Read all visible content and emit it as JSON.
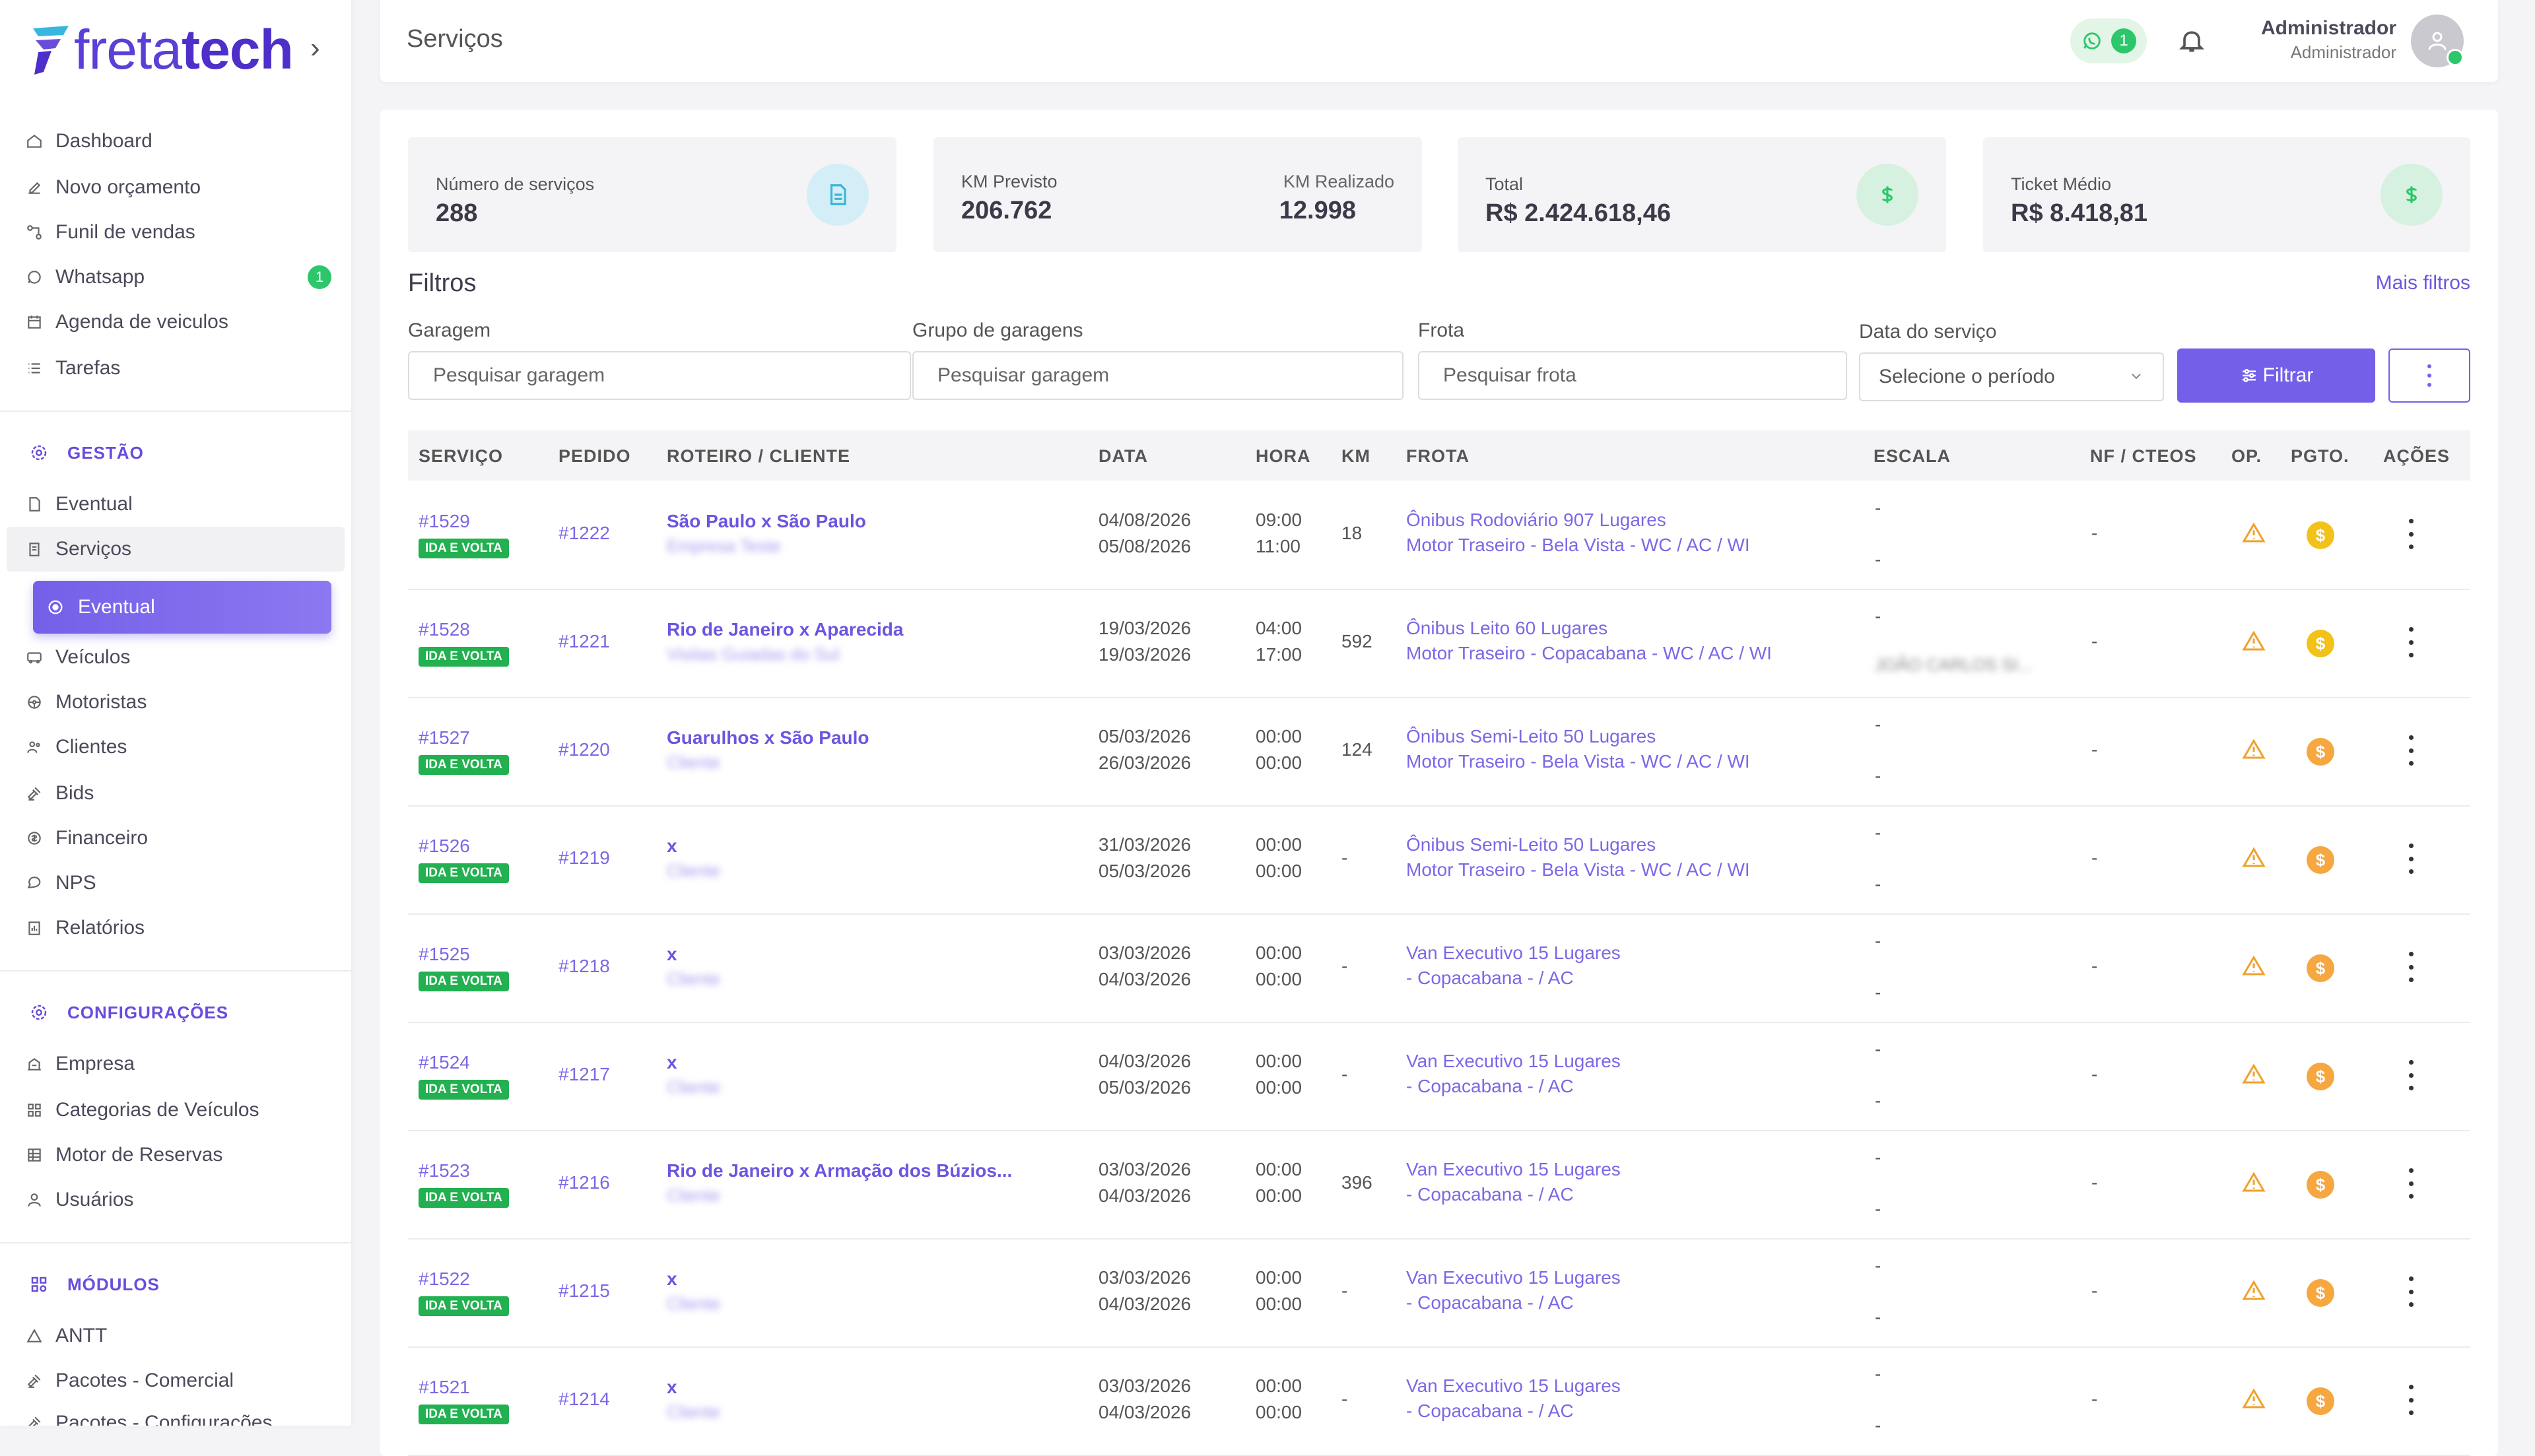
{
  "brand": {
    "name_light": "freta",
    "name_bold": "tech",
    "accent": "#6a4cdc"
  },
  "sidebar": {
    "top_items": [
      {
        "label": "Dashboard",
        "icon": "home-icon"
      },
      {
        "label": "Novo orçamento",
        "icon": "edit-icon"
      },
      {
        "label": "Funil de vendas",
        "icon": "funnel-icon"
      },
      {
        "label": "Whatsapp",
        "icon": "whatsapp-icon",
        "badge": "1"
      },
      {
        "label": "Agenda de veiculos",
        "icon": "calendar-icon"
      },
      {
        "label": "Tarefas",
        "icon": "list-icon"
      }
    ],
    "gestao": {
      "title": "GESTÃO",
      "items": [
        {
          "label": "Eventual",
          "icon": "document-icon"
        },
        {
          "label": "Serviços",
          "icon": "clipboard-icon"
        },
        {
          "label": "Veículos",
          "icon": "bus-icon"
        },
        {
          "label": "Motoristas",
          "icon": "steering-wheel-icon"
        },
        {
          "label": "Clientes",
          "icon": "users-icon"
        },
        {
          "label": "Bids",
          "icon": "gavel-icon"
        },
        {
          "label": "Financeiro",
          "icon": "money-icon"
        },
        {
          "label": "NPS",
          "icon": "chat-icon"
        },
        {
          "label": "Relatórios",
          "icon": "report-icon"
        }
      ],
      "active_sub": "Eventual"
    },
    "configuracoes": {
      "title": "CONFIGURAÇÕES",
      "items": [
        {
          "label": "Empresa",
          "icon": "building-icon"
        },
        {
          "label": "Categorias de Veículos",
          "icon": "grid-icon"
        },
        {
          "label": "Motor de Reservas",
          "icon": "table-icon"
        },
        {
          "label": "Usuários",
          "icon": "user-icon"
        }
      ]
    },
    "modulos": {
      "title": "MÓDULOS",
      "items": [
        {
          "label": "ANTT",
          "icon": "triangle-icon"
        },
        {
          "label": "Pacotes - Comercial",
          "icon": "gavel-icon"
        },
        {
          "label": "Pacotes - Configurações",
          "icon": "gavel-icon"
        }
      ]
    }
  },
  "header": {
    "title": "Serviços",
    "whatsapp_count": "1",
    "user_name": "Administrador",
    "user_role": "Administrador"
  },
  "stats": {
    "servicos": {
      "label": "Número de serviços",
      "value": "288"
    },
    "km_previsto": {
      "label": "KM Previsto",
      "value": "206.762"
    },
    "km_realizado": {
      "label": "KM Realizado",
      "value": "12.998"
    },
    "total": {
      "label": "Total",
      "value": "R$ 2.424.618,46"
    },
    "ticket": {
      "label": "Ticket Médio",
      "value": "R$ 8.418,81"
    }
  },
  "filters": {
    "title": "Filtros",
    "more": "Mais filtros",
    "garagem": {
      "label": "Garagem",
      "placeholder": "Pesquisar garagem"
    },
    "grupo": {
      "label": "Grupo de garagens",
      "placeholder": "Pesquisar garagem"
    },
    "frota": {
      "label": "Frota",
      "placeholder": "Pesquisar frota"
    },
    "data": {
      "label": "Data do serviço",
      "placeholder": "Selecione o período"
    },
    "button": "Filtrar"
  },
  "table": {
    "headers": [
      "SERVIÇO",
      "PEDIDO",
      "ROTEIRO / CLIENTE",
      "DATA",
      "HORA",
      "KM",
      "FROTA",
      "ESCALA",
      "NF / CTEOS",
      "OP.",
      "PGTO.",
      "AÇÕES"
    ],
    "rows": [
      {
        "servico": "#1529",
        "tag": "IDA E VOLTA",
        "pedido": "#1222",
        "roteiro": "São Paulo x São Paulo",
        "cliente": "Empresa Teste",
        "data1": "04/08/2026",
        "data2": "05/08/2026",
        "hora1": "09:00",
        "hora2": "11:00",
        "km": "18",
        "frota1": "Ônibus Rodoviário 907 Lugares",
        "frota2": "Motor Traseiro - Bela Vista - WC / AC / WI",
        "escala1": "-",
        "escala2": "-",
        "nf": "-",
        "pay": "yellow"
      },
      {
        "servico": "#1528",
        "tag": "IDA E VOLTA",
        "pedido": "#1221",
        "roteiro": "Rio de Janeiro x Aparecida",
        "cliente": "Visitas Guiadas do Sul",
        "data1": "19/03/2026",
        "data2": "19/03/2026",
        "hora1": "04:00",
        "hora2": "17:00",
        "km": "592",
        "frota1": "Ônibus Leito 60 Lugares",
        "frota2": "Motor Traseiro - Copacabana - WC / AC / WI",
        "escala1": "-",
        "escala2": "JOÃO CARLOS SI...",
        "nf": "-",
        "pay": "yellow"
      },
      {
        "servico": "#1527",
        "tag": "IDA E VOLTA",
        "pedido": "#1220",
        "roteiro": "Guarulhos x São Paulo",
        "cliente": "Cliente",
        "data1": "05/03/2026",
        "data2": "26/03/2026",
        "hora1": "00:00",
        "hora2": "00:00",
        "km": "124",
        "frota1": "Ônibus Semi-Leito 50 Lugares",
        "frota2": "Motor Traseiro - Bela Vista - WC / AC / WI",
        "escala1": "-",
        "escala2": "-",
        "nf": "-",
        "pay": "orange"
      },
      {
        "servico": "#1526",
        "tag": "IDA E VOLTA",
        "pedido": "#1219",
        "roteiro": "x",
        "cliente": "Cliente",
        "data1": "31/03/2026",
        "data2": "05/03/2026",
        "hora1": "00:00",
        "hora2": "00:00",
        "km": "-",
        "frota1": "Ônibus Semi-Leito 50 Lugares",
        "frota2": "Motor Traseiro - Bela Vista - WC / AC / WI",
        "escala1": "-",
        "escala2": "-",
        "nf": "-",
        "pay": "orange"
      },
      {
        "servico": "#1525",
        "tag": "IDA E VOLTA",
        "pedido": "#1218",
        "roteiro": "x",
        "cliente": "Cliente",
        "data1": "03/03/2026",
        "data2": "04/03/2026",
        "hora1": "00:00",
        "hora2": "00:00",
        "km": "-",
        "frota1": "Van Executivo 15 Lugares",
        "frota2": "- Copacabana - / AC",
        "escala1": "-",
        "escala2": "-",
        "nf": "-",
        "pay": "orange"
      },
      {
        "servico": "#1524",
        "tag": "IDA E VOLTA",
        "pedido": "#1217",
        "roteiro": "x",
        "cliente": "Cliente",
        "data1": "04/03/2026",
        "data2": "05/03/2026",
        "hora1": "00:00",
        "hora2": "00:00",
        "km": "-",
        "frota1": "Van Executivo 15 Lugares",
        "frota2": "- Copacabana - / AC",
        "escala1": "-",
        "escala2": "-",
        "nf": "-",
        "pay": "orange"
      },
      {
        "servico": "#1523",
        "tag": "IDA E VOLTA",
        "pedido": "#1216",
        "roteiro": "Rio de Janeiro x Armação dos Búzios...",
        "cliente": "Cliente",
        "data1": "03/03/2026",
        "data2": "04/03/2026",
        "hora1": "00:00",
        "hora2": "00:00",
        "km": "396",
        "frota1": "Van Executivo 15 Lugares",
        "frota2": "- Copacabana - / AC",
        "escala1": "-",
        "escala2": "-",
        "nf": "-",
        "pay": "orange"
      },
      {
        "servico": "#1522",
        "tag": "IDA E VOLTA",
        "pedido": "#1215",
        "roteiro": "x",
        "cliente": "Cliente",
        "data1": "03/03/2026",
        "data2": "04/03/2026",
        "hora1": "00:00",
        "hora2": "00:00",
        "km": "-",
        "frota1": "Van Executivo 15 Lugares",
        "frota2": "- Copacabana - / AC",
        "escala1": "-",
        "escala2": "-",
        "nf": "-",
        "pay": "orange"
      },
      {
        "servico": "#1521",
        "tag": "IDA E VOLTA",
        "pedido": "#1214",
        "roteiro": "x",
        "cliente": "Cliente",
        "data1": "03/03/2026",
        "data2": "04/03/2026",
        "hora1": "00:00",
        "hora2": "00:00",
        "km": "-",
        "frota1": "Van Executivo 15 Lugares",
        "frota2": "- Copacabana - / AC",
        "escala1": "-",
        "escala2": "-",
        "nf": "-",
        "pay": "orange"
      }
    ]
  }
}
